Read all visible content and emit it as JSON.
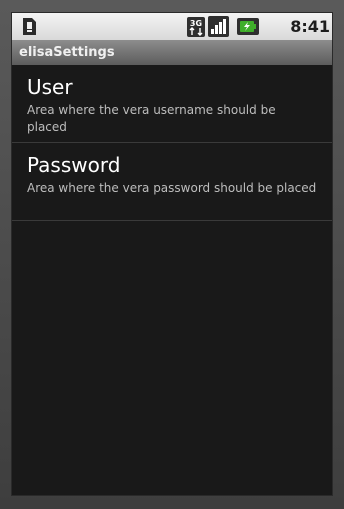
{
  "status_bar": {
    "notification_icon": "sim-card-alert-icon",
    "network_badge": "3G",
    "signal_icon": "signal-bars-icon",
    "battery_icon": "battery-charging-icon",
    "time": "8:41 PM"
  },
  "title_bar": {
    "title": "elisaSettings"
  },
  "preferences": [
    {
      "title": "User",
      "summary": "Area where the vera username should be placed"
    },
    {
      "title": "Password",
      "summary": "Area where the vera password should be placed"
    }
  ],
  "colors": {
    "background": "#191919",
    "status_bar": "#e8e8e8",
    "title_bar": "#6f6f6f",
    "battery_accent": "#3fae2a"
  }
}
